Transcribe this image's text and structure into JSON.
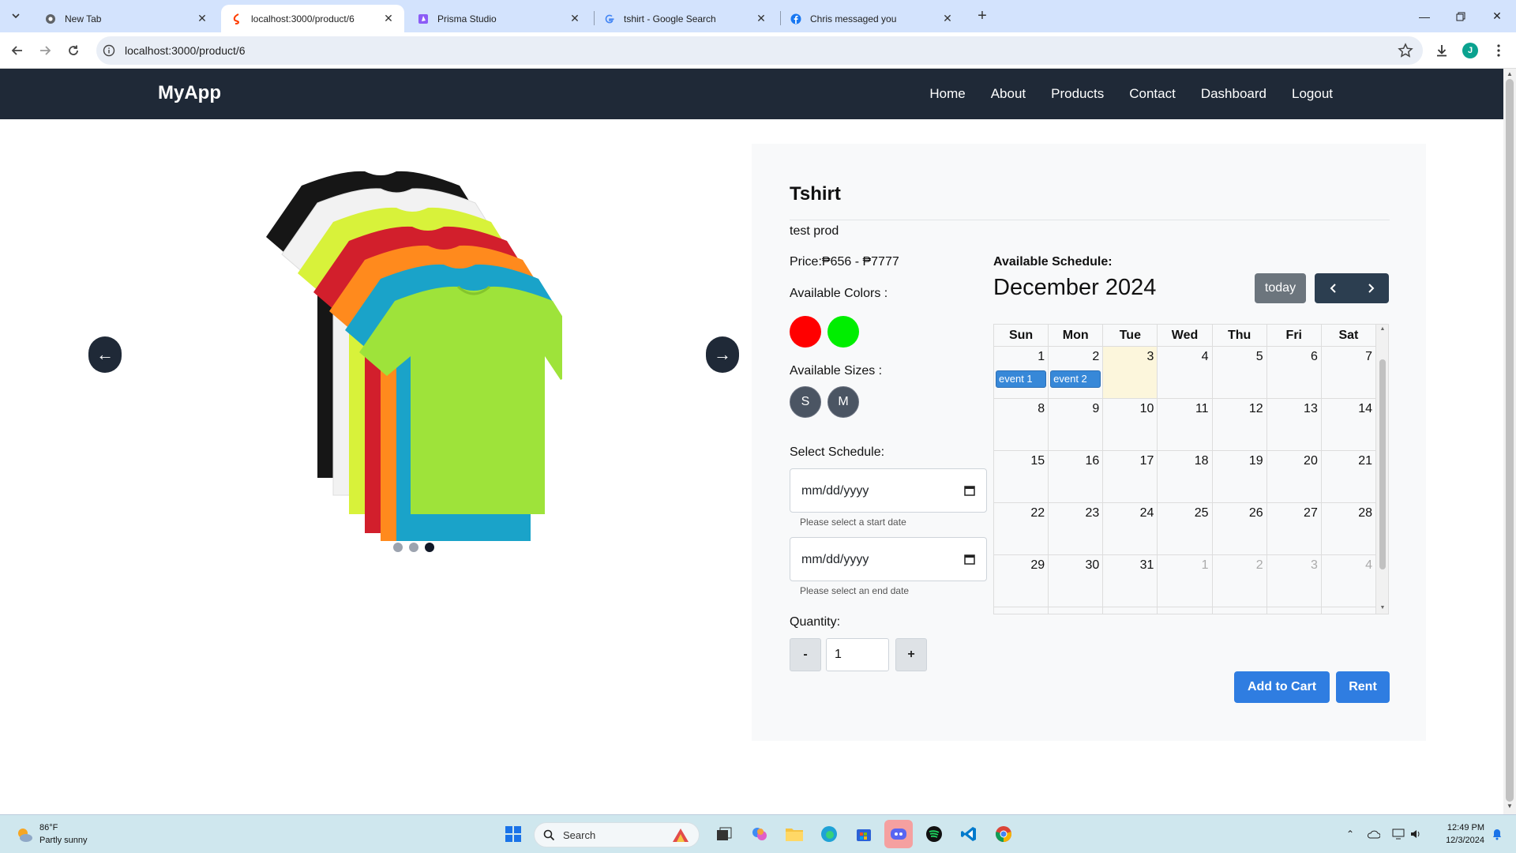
{
  "browser": {
    "tabs": [
      {
        "label": "New Tab",
        "active": false
      },
      {
        "label": "localhost:3000/product/6",
        "active": true
      },
      {
        "label": "Prisma Studio",
        "active": false
      },
      {
        "label": "tshirt - Google Search",
        "active": false
      },
      {
        "label": "Chris messaged you",
        "active": false
      }
    ],
    "url": "localhost:3000/product/6",
    "profile_initial": "J"
  },
  "app": {
    "brand": "MyApp",
    "nav": [
      "Home",
      "About",
      "Products",
      "Contact",
      "Dashboard",
      "Logout"
    ]
  },
  "carousel": {
    "prev": "←",
    "next": "→",
    "slide_count": 3,
    "active_slide": 3
  },
  "product": {
    "name": "Tshirt",
    "description": "test prod",
    "price": "Price:₱656 - ₱7777",
    "colors_label": "Available Colors :",
    "colors": [
      "#ff0000",
      "#00ee00"
    ],
    "sizes_label": "Available Sizes :",
    "sizes": [
      "S",
      "M"
    ],
    "schedule_label": "Select Schedule:",
    "start_date": {
      "value": "mm/dd/yyyy",
      "hint": "Please select a start date"
    },
    "end_date": {
      "value": "mm/dd/yyyy",
      "hint": "Please select an end date"
    },
    "quantity_label": "Quantity:",
    "quantity": "1",
    "minus": "-",
    "plus": "+",
    "add_to_cart": "Add to Cart",
    "rent": "Rent"
  },
  "calendar": {
    "label": "Available Schedule:",
    "title": "December 2024",
    "today_button": "today",
    "weekdays": [
      "Sun",
      "Mon",
      "Tue",
      "Wed",
      "Thu",
      "Fri",
      "Sat"
    ],
    "weeks": [
      [
        "1",
        "2",
        "3",
        "4",
        "5",
        "6",
        "7"
      ],
      [
        "8",
        "9",
        "10",
        "11",
        "12",
        "13",
        "14"
      ],
      [
        "15",
        "16",
        "17",
        "18",
        "19",
        "20",
        "21"
      ],
      [
        "22",
        "23",
        "24",
        "25",
        "26",
        "27",
        "28"
      ],
      [
        "29",
        "30",
        "31",
        "1",
        "2",
        "3",
        "4"
      ]
    ],
    "today_day": "3",
    "events": [
      {
        "day": "1",
        "title": "event 1"
      },
      {
        "day": "2",
        "title": "event 2"
      }
    ]
  },
  "taskbar": {
    "weather_temp": "86°F",
    "weather_desc": "Partly sunny",
    "search_placeholder": "Search",
    "time": "12:49 PM",
    "date": "12/3/2024"
  },
  "colors": {
    "nav_bg": "#1f2937",
    "primary": "#2f7de1",
    "event": "#3788d8",
    "today_bg": "#fcf6dc"
  }
}
